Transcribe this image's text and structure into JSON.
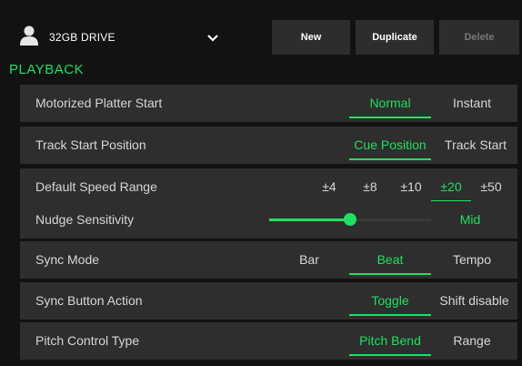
{
  "header": {
    "drive_label": "32GB DRIVE",
    "buttons": {
      "new": "New",
      "duplicate": "Duplicate",
      "delete": "Delete"
    }
  },
  "section_title": "PLAYBACK",
  "rows": {
    "platter": {
      "label": "Motorized Platter Start",
      "options": [
        "Normal",
        "Instant"
      ],
      "selected": "Normal"
    },
    "track_start": {
      "label": "Track Start Position",
      "options": [
        "Cue Position",
        "Track Start"
      ],
      "selected": "Cue Position"
    },
    "speed_range": {
      "label": "Default Speed Range",
      "options": [
        "±4",
        "±8",
        "±10",
        "±20",
        "±50"
      ],
      "selected": "±20"
    },
    "nudge": {
      "label": "Nudge Sensitivity",
      "value_label": "Mid",
      "level_percent": 50
    },
    "sync_mode": {
      "label": "Sync Mode",
      "options": [
        "Bar",
        "Beat",
        "Tempo"
      ],
      "selected": "Beat"
    },
    "sync_button": {
      "label": "Sync Button Action",
      "options": [
        "Toggle",
        "Shift disable"
      ],
      "selected": "Toggle"
    },
    "pitch_control": {
      "label": "Pitch Control Type",
      "options": [
        "Pitch Bend",
        "Range"
      ],
      "selected": "Pitch Bend"
    }
  },
  "colors": {
    "accent": "#1de15f",
    "row_bg": "#2e2e2e",
    "background": "#121212"
  }
}
